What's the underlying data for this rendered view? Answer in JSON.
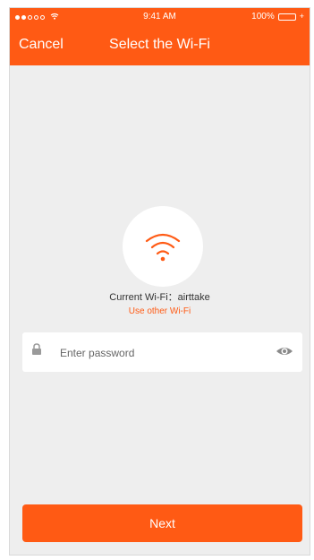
{
  "status_bar": {
    "time": "9:41 AM",
    "battery": "100%",
    "signal_full_bars": 2,
    "signal_total_bars": 5
  },
  "nav": {
    "cancel_label": "Cancel",
    "title": "Select the Wi-Fi"
  },
  "wifi": {
    "current_label": "Current Wi-Fi：airttake",
    "use_other_label": "Use other Wi-Fi"
  },
  "password": {
    "placeholder": "Enter password",
    "value": ""
  },
  "actions": {
    "next_label": "Next"
  },
  "colors": {
    "accent": "#ff5a14",
    "background": "#eeeeee",
    "card": "#ffffff"
  },
  "icons": {
    "status_wifi": "wifi-icon",
    "main_wifi": "wifi-icon",
    "lock": "lock-icon",
    "eye": "eye-icon",
    "charging": "bolt-icon"
  }
}
